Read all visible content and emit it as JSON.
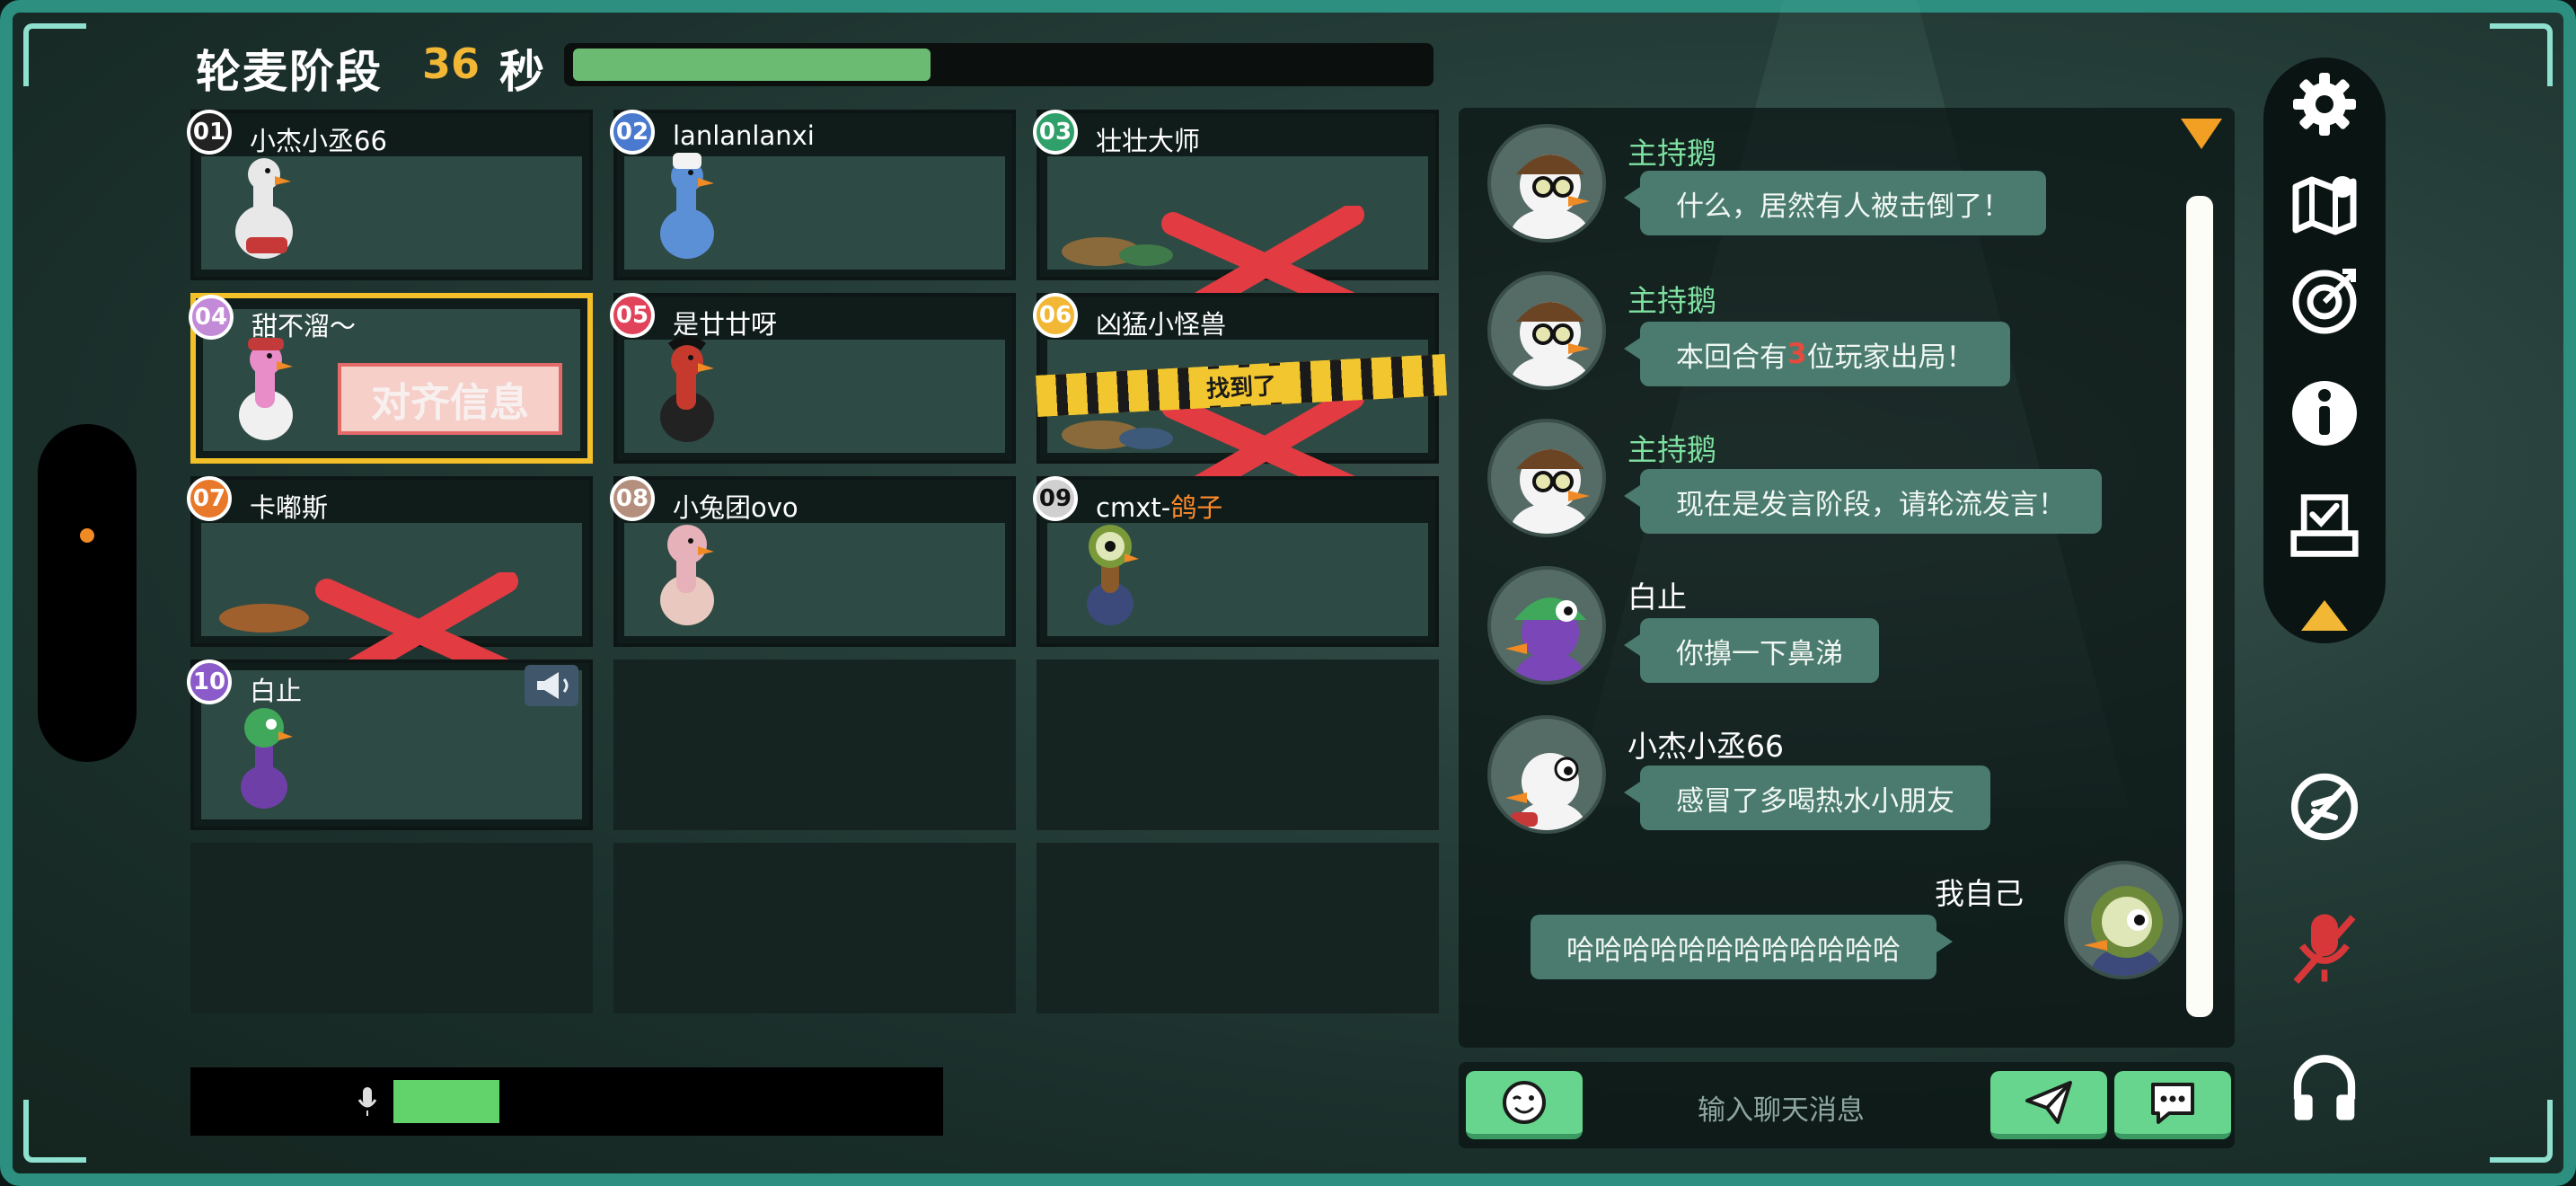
{
  "header": {
    "phase_label": "轮麦阶段",
    "seconds": "36",
    "seconds_unit": "秒",
    "timer_progress": 0.42
  },
  "players": [
    {
      "num": "01",
      "name": "小杰小丞66",
      "eliminated": false,
      "color": "#ffffff"
    },
    {
      "num": "02",
      "name": "lanlanlanxi",
      "eliminated": false,
      "color": "#4a7ad0"
    },
    {
      "num": "03",
      "name": "壮壮大师",
      "eliminated": true,
      "color": "#2fa06a"
    },
    {
      "num": "04",
      "name": "甜不溜～",
      "eliminated": false,
      "color": "#c38ad8",
      "active": true
    },
    {
      "num": "05",
      "name": "是廿廿呀",
      "eliminated": false,
      "color": "#e0435a"
    },
    {
      "num": "06",
      "name": "凶猛小怪兽",
      "eliminated": true,
      "color": "#f2b835",
      "found_label": "找到了"
    },
    {
      "num": "07",
      "name": "卡嘟斯",
      "eliminated": true,
      "color": "#e8782a"
    },
    {
      "num": "08",
      "name": "小兔团ovo",
      "eliminated": false,
      "color": "#b58f7d"
    },
    {
      "num": "09",
      "name_prefix": "cmxt-",
      "name_suffix": "鸽子",
      "eliminated": false,
      "color": "#d0d0d0"
    },
    {
      "num": "10",
      "name": "白止",
      "eliminated": false,
      "color": "#8b5cc9",
      "speaking": true
    }
  ],
  "sign_text": "对齐信息",
  "chat": {
    "messages": [
      {
        "sender": "主持鹅",
        "text": "什么，居然有人被击倒了！",
        "role": "host"
      },
      {
        "sender": "主持鹅",
        "text_before": "本回合有",
        "text_highlight": "3",
        "text_after": "位玩家出局！",
        "role": "host"
      },
      {
        "sender": "主持鹅",
        "text": "现在是发言阶段，请轮流发言！",
        "role": "host"
      },
      {
        "sender": "白止",
        "text": "你擤一下鼻涕",
        "role": "player"
      },
      {
        "sender": "小杰小丞66",
        "text": "感冒了多喝热水小朋友",
        "role": "player"
      },
      {
        "sender": "我自己",
        "text": "哈哈哈哈哈哈哈哈哈哈哈哈",
        "role": "self"
      }
    ],
    "input_placeholder": "输入聊天消息"
  },
  "toolbar": {
    "icons": [
      "gear-icon",
      "map-icon",
      "target-icon",
      "info-icon",
      "vote-box-icon",
      "collapse-up-icon",
      "camera-off-icon",
      "mic-muted-icon",
      "headphones-icon"
    ]
  },
  "colors": {
    "accent": "#2c8f80",
    "host_name": "#7ee0a0",
    "bubble": "#4a7b6e",
    "active_border": "#f3c02a",
    "button": "#67d58d"
  }
}
